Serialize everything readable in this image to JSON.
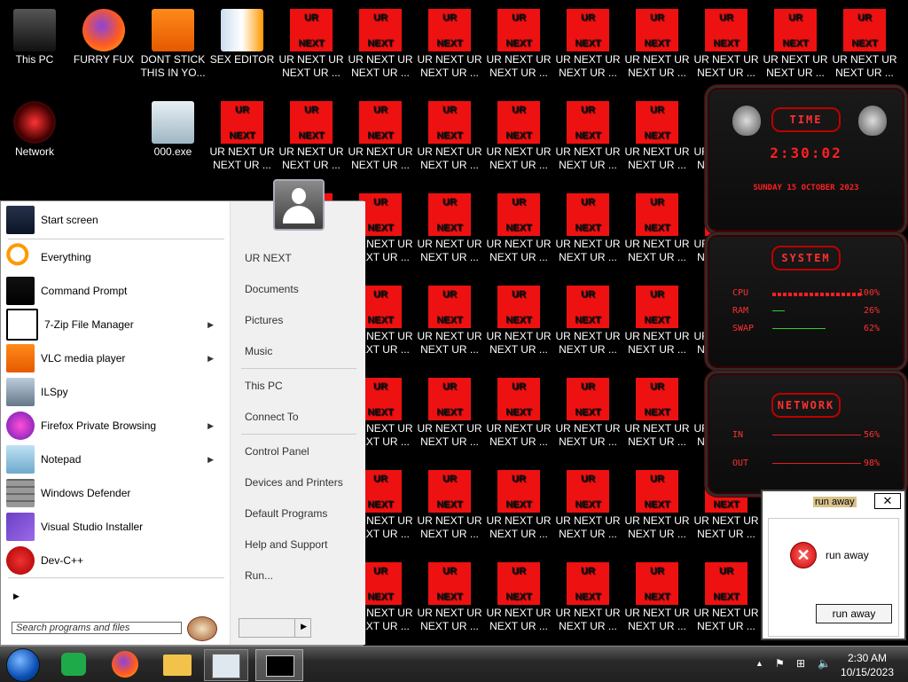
{
  "desktop": {
    "icons": [
      {
        "label": "This PC"
      },
      {
        "label": "FURRY FUX"
      },
      {
        "label": "DONT STICK\nTHIS IN YO..."
      },
      {
        "label": "SEX EDITOR"
      },
      {
        "label": "Network"
      },
      {
        "label": "000.exe"
      }
    ],
    "urnext_icon": {
      "top_text": "UR",
      "bottom_text": "NEXT",
      "label": "UR NEXT UR\nNEXT UR ..."
    }
  },
  "widgets": {
    "time": {
      "title": "TIME",
      "clock": "2:30:02",
      "date": "SUNDAY 15 OCTOBER 2023"
    },
    "system": {
      "title": "SYSTEM",
      "rows": [
        {
          "label": "CPU",
          "value": "100%"
        },
        {
          "label": "RAM",
          "value": "26%"
        },
        {
          "label": "SWAP",
          "value": "62%"
        }
      ]
    },
    "network": {
      "title": "NETWORK",
      "rows": [
        {
          "label": "IN",
          "value": "56%"
        },
        {
          "label": "OUT",
          "value": "98%"
        }
      ]
    }
  },
  "start_menu": {
    "programs": [
      {
        "label": "Start screen",
        "icon": "start-screen-icon",
        "submenu": false
      },
      {
        "label": "Everything",
        "icon": "magnifier-icon",
        "submenu": false
      },
      {
        "label": "Command Prompt",
        "icon": "cmd-icon",
        "submenu": false
      },
      {
        "label": "7-Zip File Manager",
        "icon": "7zip-icon",
        "submenu": true
      },
      {
        "label": "VLC media player",
        "icon": "vlc-cone-icon",
        "submenu": true
      },
      {
        "label": "ILSpy",
        "icon": "ilspy-icon",
        "submenu": false
      },
      {
        "label": "Firefox Private Browsing",
        "icon": "firefox-private-icon",
        "submenu": true
      },
      {
        "label": "Notepad",
        "icon": "notepad-icon",
        "submenu": true
      },
      {
        "label": "Windows Defender",
        "icon": "brick-wall-icon",
        "submenu": false
      },
      {
        "label": "Visual Studio Installer",
        "icon": "visual-studio-icon",
        "submenu": false
      },
      {
        "label": "Dev-C++",
        "icon": "devcpp-icon",
        "submenu": false
      }
    ],
    "right_items": [
      {
        "label": "UR NEXT"
      },
      {
        "label": "Documents"
      },
      {
        "label": "Pictures"
      },
      {
        "label": "Music"
      },
      {
        "label": "This PC"
      },
      {
        "label": "Connect To"
      },
      {
        "label": "Control Panel"
      },
      {
        "label": "Devices and Printers"
      },
      {
        "label": "Default Programs"
      },
      {
        "label": "Help and Support"
      },
      {
        "label": "Run..."
      }
    ],
    "search_placeholder": "Search programs and files"
  },
  "dialog": {
    "title": "run away",
    "close": "✕",
    "message": "run away",
    "button": "run away"
  },
  "taskbar": {
    "time": "2:30 AM",
    "date": "10/15/2023"
  }
}
